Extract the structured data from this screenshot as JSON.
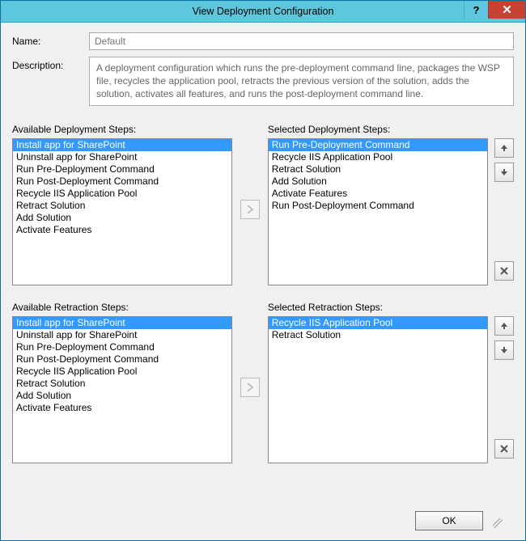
{
  "window": {
    "title": "View Deployment Configuration"
  },
  "fields": {
    "name_label": "Name:",
    "name_value": "Default",
    "description_label": "Description:",
    "description_value": "A deployment configuration which runs the pre-deployment command line, packages the WSP file, recycles the application pool, retracts the previous version of the solution, adds the solution, activates all features, and runs the post-deployment command line."
  },
  "labels": {
    "available_deployment": "Available Deployment Steps:",
    "selected_deployment": "Selected Deployment Steps:",
    "available_retraction": "Available Retraction Steps:",
    "selected_retraction": "Selected Retraction Steps:"
  },
  "lists": {
    "available_deployment": [
      "Install app for SharePoint",
      "Uninstall app for SharePoint",
      "Run Pre-Deployment Command",
      "Run Post-Deployment Command",
      "Recycle IIS Application Pool",
      "Retract Solution",
      "Add Solution",
      "Activate Features"
    ],
    "available_deployment_selected_index": 0,
    "selected_deployment": [
      "Run Pre-Deployment Command",
      "Recycle IIS Application Pool",
      "Retract Solution",
      "Add Solution",
      "Activate Features",
      "Run Post-Deployment Command"
    ],
    "selected_deployment_selected_index": 0,
    "available_retraction": [
      "Install app for SharePoint",
      "Uninstall app for SharePoint",
      "Run Pre-Deployment Command",
      "Run Post-Deployment Command",
      "Recycle IIS Application Pool",
      "Retract Solution",
      "Add Solution",
      "Activate Features"
    ],
    "available_retraction_selected_index": 0,
    "selected_retraction": [
      "Recycle IIS Application Pool",
      "Retract Solution"
    ],
    "selected_retraction_selected_index": 0
  },
  "buttons": {
    "ok": "OK"
  }
}
